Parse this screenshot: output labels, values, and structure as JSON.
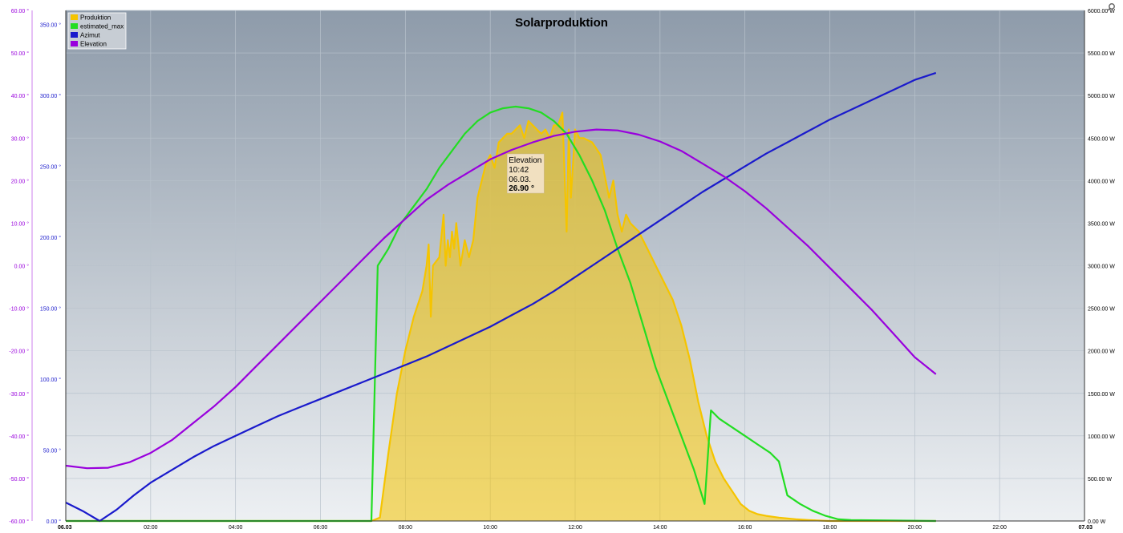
{
  "chart_data": {
    "type": "line",
    "title": "Solarproduktion",
    "legend_position": "top-left",
    "grid": true,
    "x_ticks": [
      "06.03",
      "02:00",
      "04:00",
      "06:00",
      "08:00",
      "10:00",
      "12:00",
      "14:00",
      "16:00",
      "18:00",
      "20:00",
      "22:00",
      "07.03"
    ],
    "x_range_hours": [
      0,
      24
    ],
    "axes": {
      "elevation": {
        "ticks": [
          "60.00 °",
          "50.00 °",
          "40.00 °",
          "30.00 °",
          "20.00 °",
          "10.00 °",
          "0.00 °",
          "-10.00 °",
          "-20.00 °",
          "-30.00 °",
          "-40.00 °",
          "-50.00 °",
          "-60.00 °"
        ],
        "range": [
          -60,
          60
        ],
        "color": "#9900dd"
      },
      "azimut": {
        "ticks": [
          "350.00 °",
          "300.00 °",
          "250.00 °",
          "200.00 °",
          "150.00 °",
          "100.00 °",
          "50.00 °",
          "0.00 °"
        ],
        "range": [
          0,
          360
        ],
        "color": "#1a1acc"
      },
      "power": {
        "ticks": [
          "6000.00 W",
          "5500.00 W",
          "5000.00 W",
          "4500.00 W",
          "4000.00 W",
          "3500.00 W",
          "3000.00 W",
          "2500.00 W",
          "2000.00 W",
          "1500.00 W",
          "1000.00 W",
          "500.00 W",
          "0.00 W"
        ],
        "range": [
          0,
          6000
        ],
        "color": "#000000"
      }
    },
    "series": [
      {
        "name": "Produktion",
        "color": "#f5c400",
        "axis": "power",
        "kind": "area",
        "points": [
          [
            0,
            0
          ],
          [
            7.2,
            0
          ],
          [
            7.4,
            40
          ],
          [
            7.6,
            800
          ],
          [
            7.8,
            1500
          ],
          [
            8.0,
            2000
          ],
          [
            8.2,
            2400
          ],
          [
            8.4,
            2700
          ],
          [
            8.5,
            3000
          ],
          [
            8.55,
            3250
          ],
          [
            8.6,
            2400
          ],
          [
            8.65,
            3000
          ],
          [
            8.8,
            3100
          ],
          [
            8.9,
            3600
          ],
          [
            8.95,
            3000
          ],
          [
            9.0,
            3300
          ],
          [
            9.05,
            3100
          ],
          [
            9.1,
            3400
          ],
          [
            9.15,
            3200
          ],
          [
            9.2,
            3500
          ],
          [
            9.3,
            3000
          ],
          [
            9.4,
            3300
          ],
          [
            9.5,
            3100
          ],
          [
            9.6,
            3300
          ],
          [
            9.7,
            3800
          ],
          [
            9.8,
            4000
          ],
          [
            9.9,
            4200
          ],
          [
            10.0,
            4300
          ],
          [
            10.1,
            4150
          ],
          [
            10.2,
            4450
          ],
          [
            10.3,
            4500
          ],
          [
            10.4,
            4550
          ],
          [
            10.5,
            4550
          ],
          [
            10.6,
            4600
          ],
          [
            10.7,
            4650
          ],
          [
            10.8,
            4500
          ],
          [
            10.9,
            4700
          ],
          [
            11.0,
            4650
          ],
          [
            11.1,
            4600
          ],
          [
            11.2,
            4550
          ],
          [
            11.3,
            4600
          ],
          [
            11.4,
            4500
          ],
          [
            11.5,
            4650
          ],
          [
            11.6,
            4650
          ],
          [
            11.7,
            4800
          ],
          [
            11.8,
            3400
          ],
          [
            11.85,
            4600
          ],
          [
            11.9,
            3800
          ],
          [
            12.0,
            4600
          ],
          [
            12.1,
            4500
          ],
          [
            12.2,
            4500
          ],
          [
            12.4,
            4450
          ],
          [
            12.6,
            4300
          ],
          [
            12.8,
            3800
          ],
          [
            12.9,
            4000
          ],
          [
            13.0,
            3600
          ],
          [
            13.1,
            3400
          ],
          [
            13.2,
            3600
          ],
          [
            13.3,
            3500
          ],
          [
            13.5,
            3400
          ],
          [
            13.7,
            3200
          ],
          [
            13.9,
            3000
          ],
          [
            14.1,
            2800
          ],
          [
            14.3,
            2600
          ],
          [
            14.5,
            2300
          ],
          [
            14.7,
            1900
          ],
          [
            14.9,
            1400
          ],
          [
            15.1,
            1000
          ],
          [
            15.3,
            700
          ],
          [
            15.5,
            500
          ],
          [
            15.7,
            350
          ],
          [
            15.9,
            200
          ],
          [
            16.1,
            120
          ],
          [
            16.3,
            80
          ],
          [
            16.5,
            60
          ],
          [
            16.8,
            40
          ],
          [
            17.2,
            20
          ],
          [
            17.5,
            10
          ],
          [
            18.0,
            0
          ],
          [
            20.5,
            0
          ]
        ]
      },
      {
        "name": "estimated_max",
        "color": "#22dd22",
        "axis": "power",
        "kind": "line",
        "points": [
          [
            0,
            0
          ],
          [
            7.2,
            0
          ],
          [
            7.35,
            3000
          ],
          [
            7.6,
            3200
          ],
          [
            7.9,
            3500
          ],
          [
            8.2,
            3700
          ],
          [
            8.5,
            3900
          ],
          [
            8.8,
            4150
          ],
          [
            9.1,
            4350
          ],
          [
            9.4,
            4550
          ],
          [
            9.7,
            4700
          ],
          [
            10.0,
            4800
          ],
          [
            10.3,
            4850
          ],
          [
            10.6,
            4870
          ],
          [
            10.9,
            4850
          ],
          [
            11.2,
            4800
          ],
          [
            11.5,
            4700
          ],
          [
            11.8,
            4550
          ],
          [
            12.1,
            4300
          ],
          [
            12.4,
            4000
          ],
          [
            12.7,
            3650
          ],
          [
            13.0,
            3200
          ],
          [
            13.3,
            2800
          ],
          [
            13.6,
            2300
          ],
          [
            13.9,
            1800
          ],
          [
            14.2,
            1400
          ],
          [
            14.5,
            1000
          ],
          [
            14.8,
            600
          ],
          [
            15.05,
            200
          ],
          [
            15.2,
            1300
          ],
          [
            15.4,
            1200
          ],
          [
            15.7,
            1100
          ],
          [
            16.0,
            1000
          ],
          [
            16.3,
            900
          ],
          [
            16.6,
            800
          ],
          [
            16.8,
            700
          ],
          [
            17.0,
            300
          ],
          [
            17.3,
            200
          ],
          [
            17.6,
            120
          ],
          [
            17.9,
            60
          ],
          [
            18.2,
            20
          ],
          [
            18.5,
            10
          ],
          [
            20.5,
            0
          ]
        ]
      },
      {
        "name": "Azimut",
        "color": "#1a1acc",
        "axis": "azimut",
        "kind": "line",
        "points": [
          [
            0,
            13
          ],
          [
            0.4,
            7
          ],
          [
            0.8,
            0
          ],
          [
            1.2,
            8
          ],
          [
            1.6,
            18
          ],
          [
            2.0,
            27
          ],
          [
            2.5,
            36
          ],
          [
            3.0,
            45
          ],
          [
            3.5,
            53
          ],
          [
            4.0,
            60
          ],
          [
            4.5,
            67
          ],
          [
            5.0,
            74
          ],
          [
            5.5,
            80
          ],
          [
            6.0,
            86
          ],
          [
            6.5,
            92
          ],
          [
            7.0,
            98
          ],
          [
            7.5,
            104
          ],
          [
            8.0,
            110
          ],
          [
            8.5,
            116
          ],
          [
            9.0,
            123
          ],
          [
            9.5,
            130
          ],
          [
            10.0,
            137
          ],
          [
            10.5,
            145
          ],
          [
            11.0,
            153
          ],
          [
            11.5,
            162
          ],
          [
            12.0,
            172
          ],
          [
            12.5,
            182
          ],
          [
            13.0,
            192
          ],
          [
            13.5,
            202
          ],
          [
            14.0,
            212
          ],
          [
            14.5,
            222
          ],
          [
            15.0,
            232
          ],
          [
            15.5,
            241
          ],
          [
            16.0,
            250
          ],
          [
            16.5,
            259
          ],
          [
            17.0,
            267
          ],
          [
            17.5,
            275
          ],
          [
            18.0,
            283
          ],
          [
            18.5,
            290
          ],
          [
            19.0,
            297
          ],
          [
            19.5,
            304
          ],
          [
            20.0,
            311
          ],
          [
            20.5,
            316
          ]
        ]
      },
      {
        "name": "Elevation",
        "color": "#9900dd",
        "axis": "elevation",
        "kind": "line",
        "points": [
          [
            0,
            -47
          ],
          [
            0.5,
            -47.6
          ],
          [
            1.0,
            -47.5
          ],
          [
            1.5,
            -46.2
          ],
          [
            2.0,
            -44
          ],
          [
            2.5,
            -41
          ],
          [
            3.0,
            -37
          ],
          [
            3.5,
            -33
          ],
          [
            4.0,
            -28.5
          ],
          [
            4.5,
            -23.5
          ],
          [
            5.0,
            -18.5
          ],
          [
            5.5,
            -13.5
          ],
          [
            6.0,
            -8.5
          ],
          [
            6.5,
            -3.5
          ],
          [
            7.0,
            1.5
          ],
          [
            7.5,
            6.5
          ],
          [
            8.0,
            11
          ],
          [
            8.5,
            15.5
          ],
          [
            9.0,
            19
          ],
          [
            9.5,
            22
          ],
          [
            10.0,
            25
          ],
          [
            10.5,
            27.2
          ],
          [
            11.0,
            29
          ],
          [
            11.5,
            30.5
          ],
          [
            12.0,
            31.5
          ],
          [
            12.5,
            32
          ],
          [
            13.0,
            31.8
          ],
          [
            13.5,
            30.8
          ],
          [
            14.0,
            29.2
          ],
          [
            14.5,
            27
          ],
          [
            15.0,
            24
          ],
          [
            15.5,
            21
          ],
          [
            16.0,
            17.5
          ],
          [
            16.5,
            13.5
          ],
          [
            17.0,
            9
          ],
          [
            17.5,
            4.5
          ],
          [
            18.0,
            -0.5
          ],
          [
            18.5,
            -5.5
          ],
          [
            19.0,
            -10.5
          ],
          [
            19.5,
            -16
          ],
          [
            20.0,
            -21.5
          ],
          [
            20.5,
            -25.5
          ]
        ]
      }
    ],
    "tooltip": {
      "series": "Elevation",
      "time": "10:42",
      "date": "06.03.",
      "value": "26.90 °",
      "at_hours": 10.7
    }
  }
}
